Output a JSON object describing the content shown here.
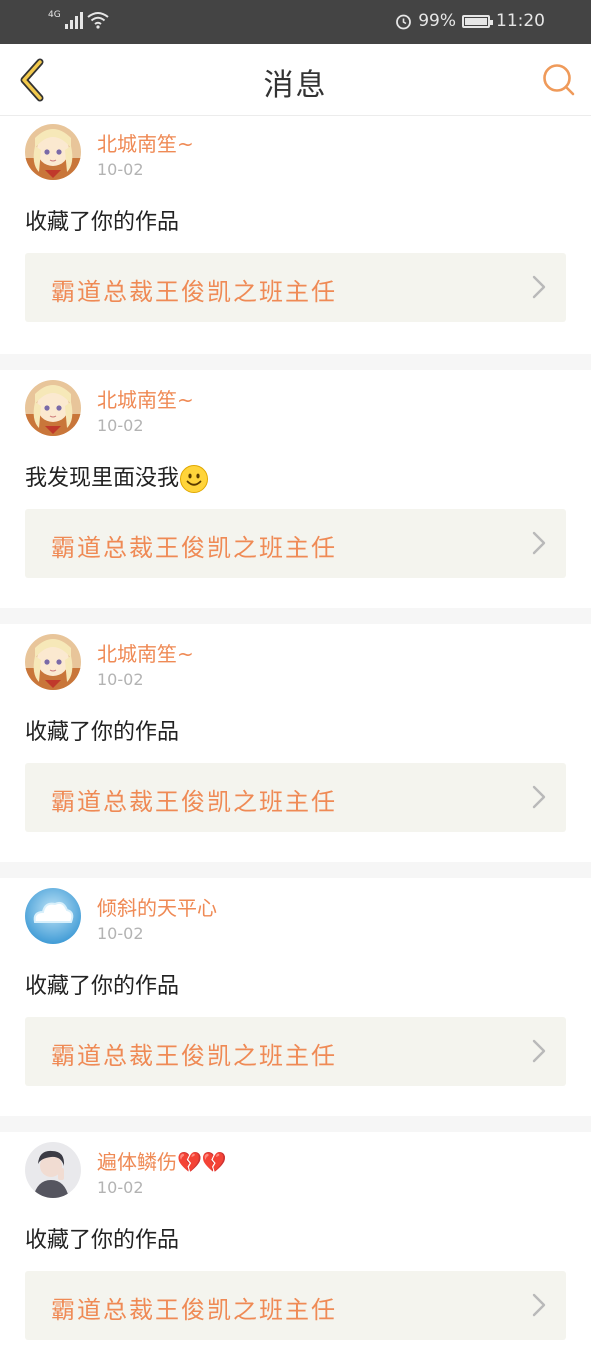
{
  "status_bar": {
    "network": "4G",
    "battery": "99%",
    "battery_level": 0.99,
    "time": "11:20"
  },
  "nav": {
    "title": "消息",
    "back_icon": "chevron-left-icon",
    "search_icon": "search-icon"
  },
  "colors": {
    "accent": "#ef8a55",
    "nav_back": "#f2c94c",
    "card_bg": "#f4f4ee",
    "status_bg": "#444444"
  },
  "messages": [
    {
      "user": "北城南笙~",
      "date": "10-02",
      "comment": "收藏了你的作品",
      "work": "霸道总裁王俊凯之班主任",
      "avatar": "anime-girl-avatar"
    },
    {
      "user": "北城南笙~",
      "date": "10-02",
      "comment": "我发现里面没我",
      "emoji": "smiley-emoji",
      "work": "霸道总裁王俊凯之班主任",
      "avatar": "anime-girl-avatar"
    },
    {
      "user": "北城南笙~",
      "date": "10-02",
      "comment": "收藏了你的作品",
      "work": "霸道总裁王俊凯之班主任",
      "avatar": "anime-girl-avatar"
    },
    {
      "user": "倾斜的天平心",
      "date": "10-02",
      "comment": "收藏了你的作品",
      "work": "霸道总裁王俊凯之班主任",
      "avatar": "cloud-avatar"
    },
    {
      "user": "遍体鳞伤",
      "user_emoji": "💔💔",
      "date": "10-02",
      "comment": "收藏了你的作品",
      "work": "霸道总裁王俊凯之班主任",
      "avatar": "photo-avatar"
    }
  ]
}
